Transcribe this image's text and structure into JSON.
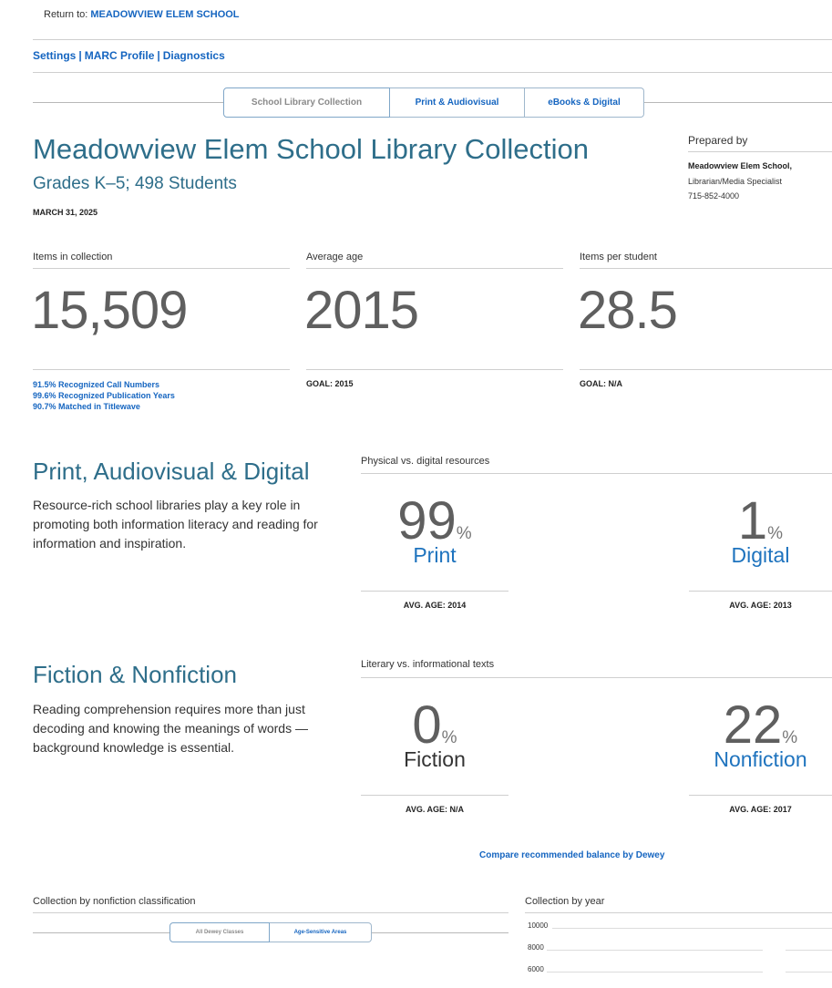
{
  "header": {
    "return_prefix": "Return to: ",
    "return_link": "MEADOWVIEW ELEM SCHOOL",
    "nav": [
      "Settings",
      "MARC Profile",
      "Diagnostics"
    ],
    "nav_sep": "|"
  },
  "tabs": [
    {
      "label": "School Library Collection",
      "active": true
    },
    {
      "label": "Print & Audiovisual",
      "active": false
    },
    {
      "label": "eBooks & Digital",
      "active": false
    }
  ],
  "report": {
    "title": "Meadowview Elem School Library Collection",
    "subtitle": "Grades K–5; 498 Students",
    "date": "MARCH 31, 2025"
  },
  "prepared": {
    "label": "Prepared by",
    "name": "Meadowview Elem School,",
    "role": "Librarian/Media Specialist",
    "phone": "715-852-4000"
  },
  "stats": {
    "items": {
      "label": "Items in collection",
      "value": "15,509"
    },
    "age": {
      "label": "Average age",
      "value": "2015",
      "goal": "GOAL: 2015"
    },
    "per_student": {
      "label": "Items per student",
      "value": "28.5",
      "goal": "GOAL: N/A"
    },
    "recognition": [
      "91.5% Recognized Call Numbers",
      "99.6% Recognized Publication Years",
      "90.7% Matched in Titlewave"
    ]
  },
  "print_section": {
    "title": "Print, Audiovisual & Digital",
    "body": "Resource-rich school libraries play a key role in promoting both information literacy and reading for information and inspiration.",
    "panel_label": "Physical vs. digital resources",
    "left": {
      "value": "99",
      "pct": "%",
      "kind": "Print",
      "avg": "AVG. AGE: 2014"
    },
    "right": {
      "value": "1",
      "pct": "%",
      "kind": "Digital",
      "avg": "AVG. AGE: 2013"
    }
  },
  "fiction_section": {
    "title": "Fiction & Nonfiction",
    "body": "Reading comprehension requires more than just decoding and knowing the meanings of words — background knowledge is essential.",
    "panel_label": "Literary vs. informational texts",
    "left": {
      "value": "0",
      "pct": "%",
      "kind": "Fiction",
      "avg": "AVG. AGE: N/A"
    },
    "right": {
      "value": "22",
      "pct": "%",
      "kind": "Nonfiction",
      "avg": "AVG. AGE: 2017"
    }
  },
  "compare_link": "Compare recommended balance by Dewey",
  "bottom": {
    "classification_label": "Collection by nonfiction classification",
    "dewey_tabs": [
      {
        "label": "All Dewey Classes",
        "active": true
      },
      {
        "label": "Age-Sensitive Areas",
        "active": false
      }
    ],
    "year_label": "Collection by year",
    "year_axis": [
      "10000",
      "8000",
      "6000"
    ]
  }
}
